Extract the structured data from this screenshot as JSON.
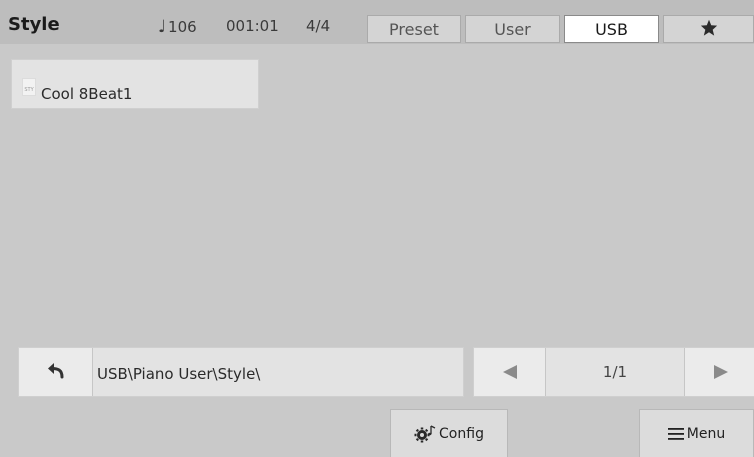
{
  "header": {
    "title": "Style",
    "tempo_icon": "quarter-note-icon",
    "tempo": "106",
    "measure": "001:01",
    "time_signature": "4/4",
    "tabs": [
      {
        "label": "Preset",
        "active": false
      },
      {
        "label": "User",
        "active": false
      },
      {
        "label": "USB",
        "active": true
      },
      {
        "label": "",
        "icon": "star-icon",
        "active": false
      }
    ]
  },
  "file_list": {
    "items": [
      {
        "label": "Cool 8Beat1",
        "icon": "style-file-icon",
        "icon_text": "STY"
      }
    ]
  },
  "path_bar": {
    "back_icon": "back-arrow-icon",
    "path": "USB\\Piano User\\Style\\"
  },
  "pager": {
    "prev_icon": "triangle-left-icon",
    "page": "1/1",
    "next_icon": "triangle-right-icon"
  },
  "footer": {
    "config_label": "Config",
    "config_icon": "gear-note-icon",
    "menu_label": "Menu",
    "menu_icon": "hamburger-icon"
  },
  "colors": {
    "background": "#c9c9c9",
    "header": "#bdbdbd",
    "active_tab": "#ffffff",
    "item": "#e3e3e3"
  }
}
